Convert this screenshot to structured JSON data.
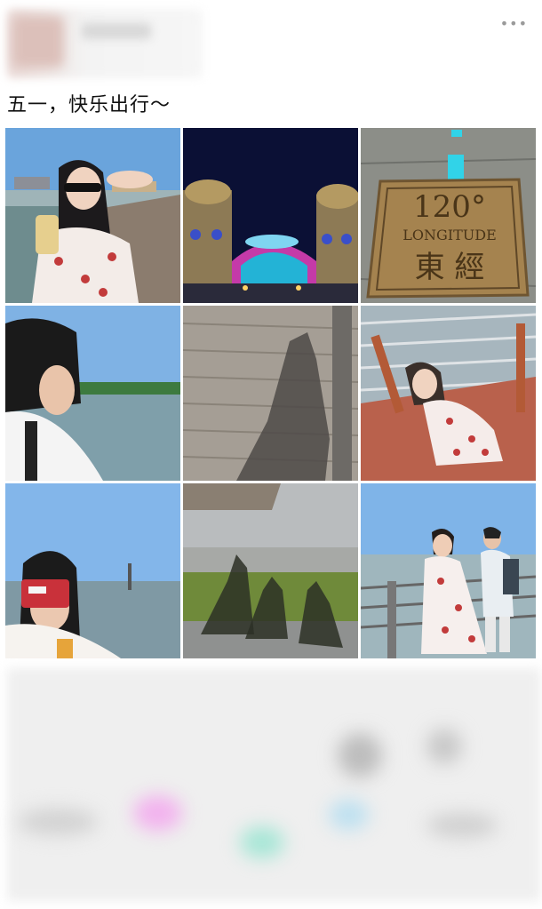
{
  "post": {
    "caption": "五一，快乐出行～",
    "more_icon": "more-dots-icon",
    "photos": [
      {
        "name": "photo-girl-sunglasses-pier"
      },
      {
        "name": "photo-night-castle-lights"
      },
      {
        "name": "photo-120-longitude-plaque",
        "plaque_number": "120°",
        "plaque_word": "LONGITUDE",
        "plaque_chinese": "東 經"
      },
      {
        "name": "photo-boy-looking-at-lake"
      },
      {
        "name": "photo-shadow-on-boardwalk"
      },
      {
        "name": "photo-girl-crouching-railing"
      },
      {
        "name": "photo-girl-holding-red-card"
      },
      {
        "name": "photo-shadows-on-grass"
      },
      {
        "name": "photo-couple-by-railing"
      }
    ]
  },
  "colors": {
    "sky": "#6aa4dc",
    "lake": "#7f9faa",
    "night": "#0b1035",
    "plaque": "#a5834f"
  }
}
